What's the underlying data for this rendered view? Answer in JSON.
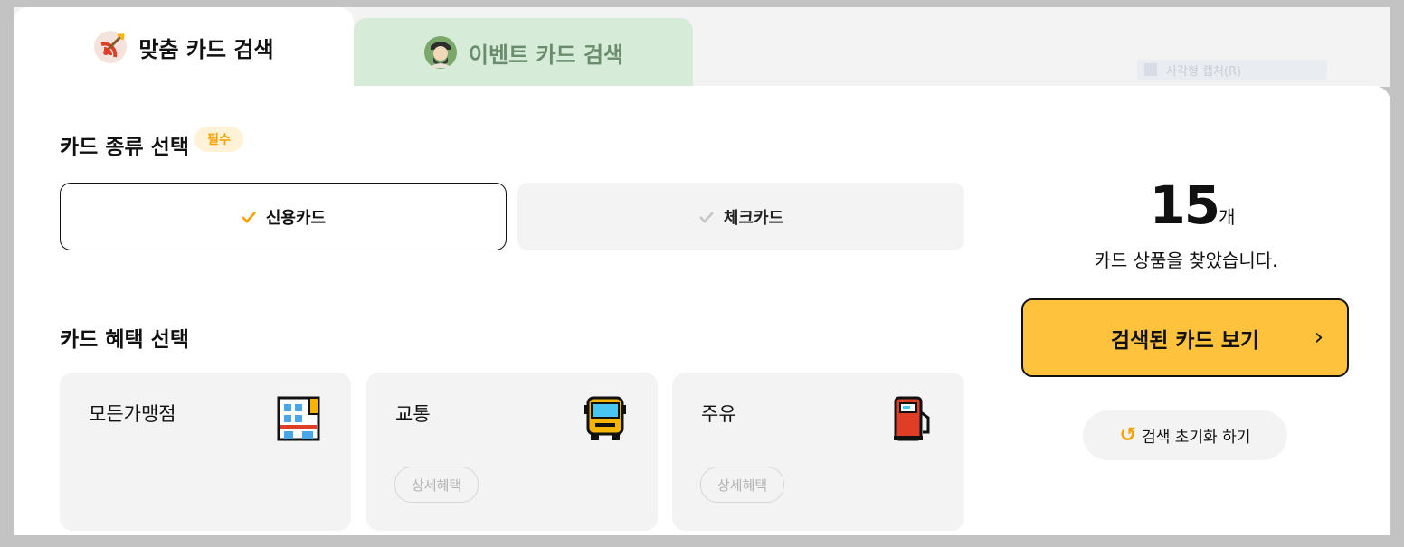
{
  "tabs": [
    {
      "label": "맞춤 카드 검색",
      "icon": "target-icon",
      "active": true
    },
    {
      "label": "이벤트 카드 검색",
      "icon": "avatar-icon",
      "active": false
    }
  ],
  "ghost_checkbox": {
    "label": "사각형 캡처(R)"
  },
  "card_type": {
    "title": "카드 종류 선택",
    "badge": "필수",
    "options": [
      {
        "label": "신용카드",
        "selected": true
      },
      {
        "label": "체크카드",
        "selected": false
      }
    ]
  },
  "benefits": {
    "title": "카드 혜택 선택",
    "items": [
      {
        "label": "모든가맹점",
        "icon": "building-icon"
      },
      {
        "label": "교통",
        "icon": "bus-icon",
        "detail": "상세혜택"
      },
      {
        "label": "주유",
        "icon": "gas-pump-icon",
        "detail": "상세혜택"
      }
    ]
  },
  "result": {
    "count": "15",
    "unit": "개",
    "message": "카드 상품을 찾았습니다.",
    "view_button": "검색된 카드 보기",
    "reset_button": "검색 초기화 하기"
  },
  "colors": {
    "accent": "#ffc23d",
    "badge_text": "#f5a200",
    "event_tab": "#d6ecd9"
  }
}
